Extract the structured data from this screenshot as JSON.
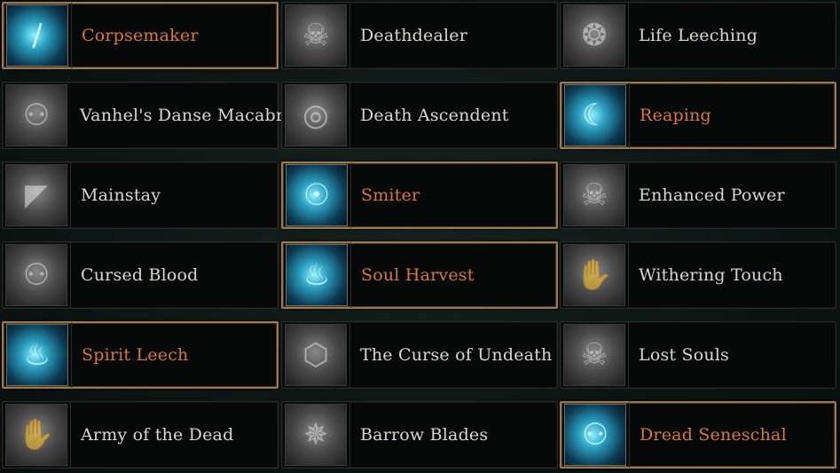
{
  "colors": {
    "active_text": "#d8783b",
    "inactive_text": "#d9d7cf",
    "active_border": "#9c7a4e"
  },
  "cards": [
    {
      "label": "Corpsemaker",
      "active": true,
      "icon": "slash-icon"
    },
    {
      "label": "Deathdealer",
      "active": false,
      "icon": "skull-icon"
    },
    {
      "label": "Life Leeching",
      "active": false,
      "icon": "vortex-hands-icon"
    },
    {
      "label": "Vanhel's Danse Macabre",
      "active": false,
      "icon": "skeleton-dance-icon"
    },
    {
      "label": "Death Ascendent",
      "active": false,
      "icon": "swirl-eye-icon"
    },
    {
      "label": "Reaping",
      "active": true,
      "icon": "scythe-slash-icon"
    },
    {
      "label": "Mainstay",
      "active": false,
      "icon": "shield-wing-icon"
    },
    {
      "label": "Smiter",
      "active": true,
      "icon": "orb-crowd-icon"
    },
    {
      "label": "Enhanced Power",
      "active": false,
      "icon": "skull-badge-icon"
    },
    {
      "label": "Cursed Blood",
      "active": false,
      "icon": "skeleton-icon"
    },
    {
      "label": "Soul Harvest",
      "active": true,
      "icon": "souls-icon"
    },
    {
      "label": "Withering Touch",
      "active": false,
      "icon": "hand-icon"
    },
    {
      "label": "Spirit Leech",
      "active": true,
      "icon": "spirit-flame-icon"
    },
    {
      "label": "The Curse of Undeath",
      "active": false,
      "icon": "ribcage-shield-icon"
    },
    {
      "label": "Lost Souls",
      "active": false,
      "icon": "screaming-skull-icon"
    },
    {
      "label": "Army of the Dead",
      "active": false,
      "icon": "rising-hands-icon"
    },
    {
      "label": "Barrow Blades",
      "active": false,
      "icon": "rune-circle-icon"
    },
    {
      "label": "Dread Seneschal",
      "active": true,
      "icon": "skeleton-lord-icon"
    }
  ]
}
